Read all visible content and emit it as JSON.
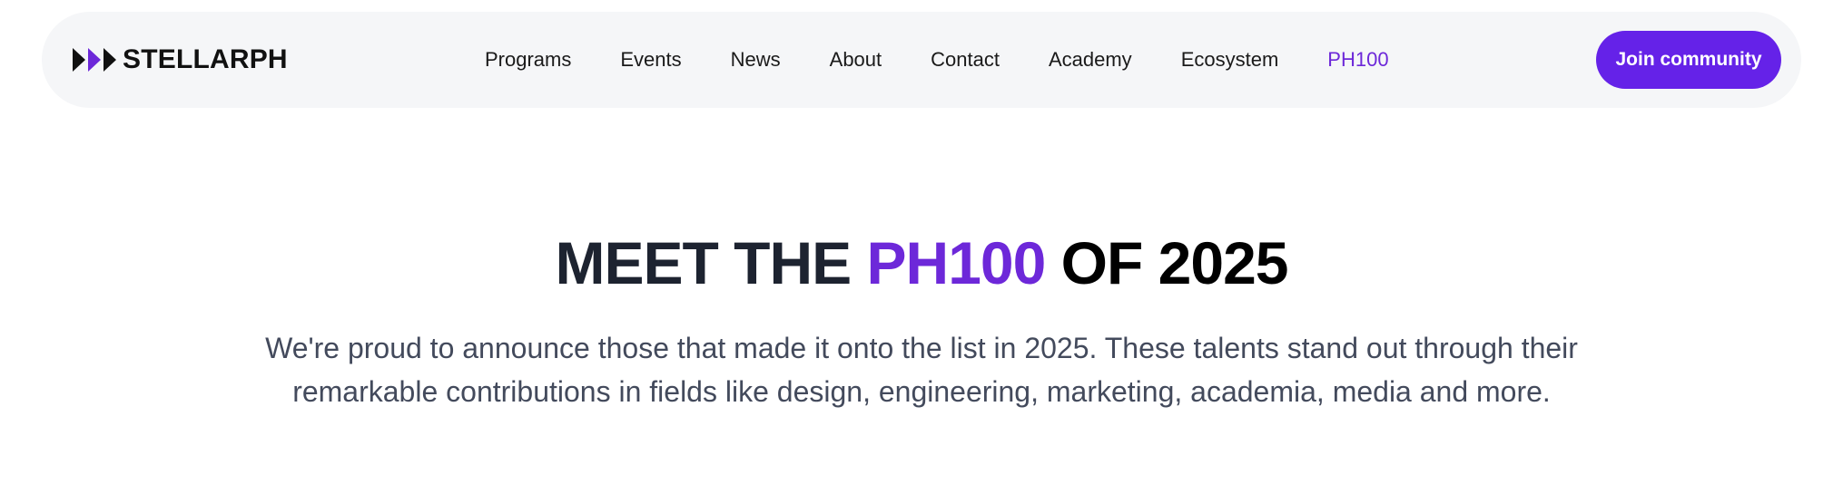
{
  "navbar": {
    "logo": {
      "icon": "triple-play-arrows-icon",
      "text": "STELLARPH"
    },
    "links": [
      {
        "label": "Programs",
        "active": false
      },
      {
        "label": "Events",
        "active": false
      },
      {
        "label": "News",
        "active": false
      },
      {
        "label": "About",
        "active": false
      },
      {
        "label": "Contact",
        "active": false
      },
      {
        "label": "Academy",
        "active": false
      },
      {
        "label": "Ecosystem",
        "active": false
      },
      {
        "label": "PH100",
        "active": true
      }
    ],
    "cta_label": "Join community"
  },
  "hero": {
    "title_part1": "MEET THE",
    "title_accent": "PH100",
    "title_part2": "OF 2025",
    "subtitle": "We're proud to announce those that made it onto the list in 2025. These talents stand out through their remarkable contributions in fields like design, engineering, marketing, academia, media and more."
  },
  "colors": {
    "accent": "#6d28d9",
    "button": "#6522e8",
    "navbar_bg": "#f5f6f8",
    "text_dark": "#1d2330",
    "text_body": "#434a5c"
  }
}
